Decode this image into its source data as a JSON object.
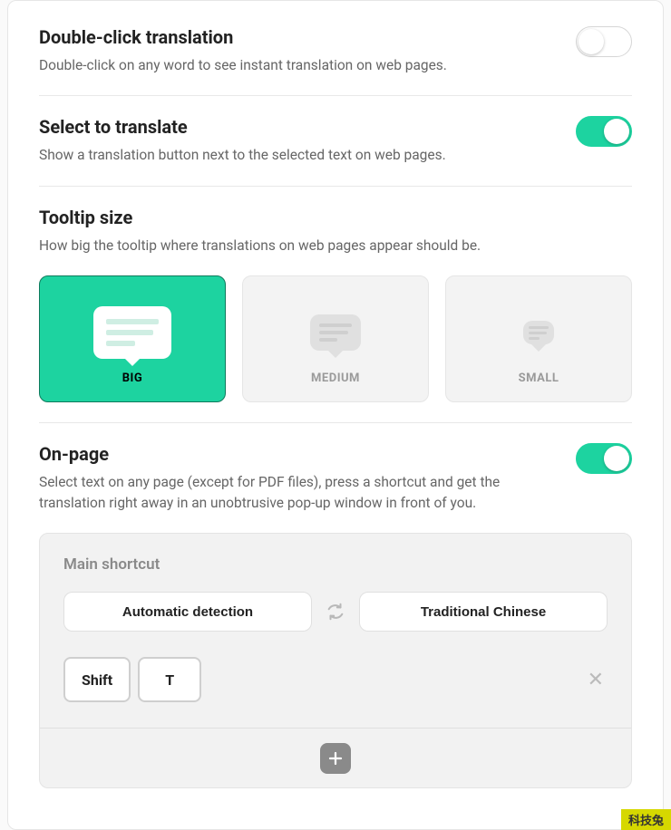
{
  "sections": {
    "doubleClick": {
      "title": "Double-click translation",
      "desc": "Double-click on any word to see instant translation on web pages.",
      "enabled": false
    },
    "selectTranslate": {
      "title": "Select to translate",
      "desc": "Show a translation button next to the selected text on web pages.",
      "enabled": true
    },
    "tooltipSize": {
      "title": "Tooltip size",
      "desc": "How big the tooltip where translations on web pages appear should be.",
      "selected": "BIG",
      "options": {
        "big": "BIG",
        "medium": "MEDIUM",
        "small": "SMALL"
      }
    },
    "onPage": {
      "title": "On-page",
      "desc": "Select text on any page (except for PDF files), press a shortcut and get the translation right away in an unobtrusive pop-up window in front of you.",
      "enabled": true
    }
  },
  "shortcut": {
    "title": "Main shortcut",
    "source": "Automatic detection",
    "target": "Traditional Chinese",
    "keys": {
      "k1": "Shift",
      "k2": "T"
    }
  },
  "watermark": "科技兔"
}
